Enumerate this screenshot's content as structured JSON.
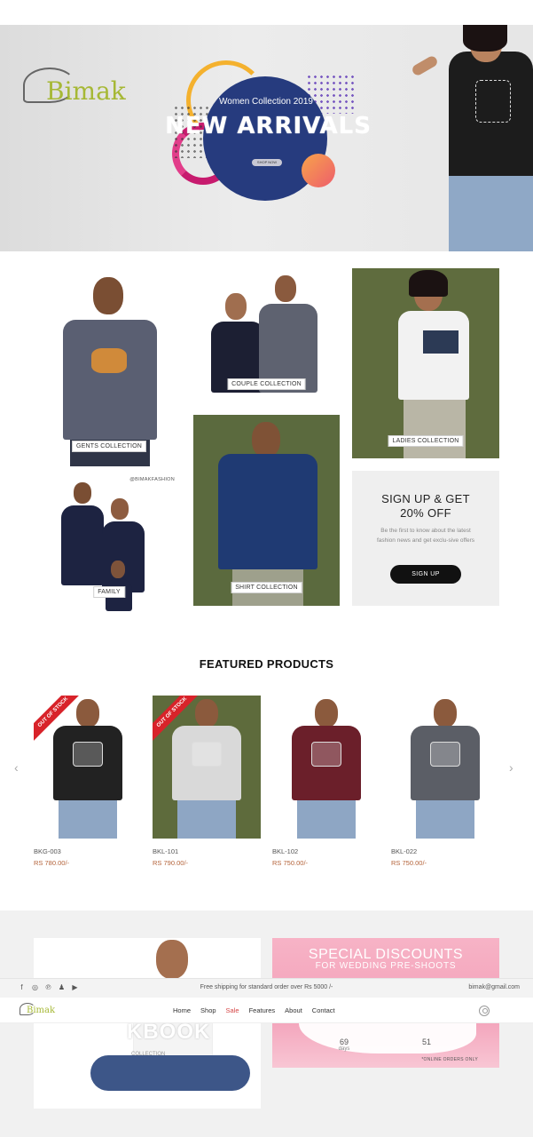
{
  "hero": {
    "logo_text": "Bimak",
    "subtitle": "Women Collection 2019",
    "title": "NEW ARRIVALS",
    "button": "SHOP NOW"
  },
  "collections": {
    "gents": "GENTS COLLECTION",
    "couple": "COUPLE COLLECTION",
    "ladies": "LADIES COLLECTION",
    "family": "FAMILY",
    "shirt": "SHIRT COLLECTION",
    "insta_tag": "@BIMAKFASHION"
  },
  "signup": {
    "title_line1": "SIGN UP & GET",
    "title_line2": "20% OFF",
    "text": "Be the first to know about the latest fashion news and get exclu-sive offers",
    "button": "SIGN UP"
  },
  "featured": {
    "title": "FEATURED PRODUCTS",
    "prev": "‹",
    "next": "›",
    "products": [
      {
        "code": "BKG-003",
        "price": "RS 780.00/-",
        "badge": "OUT OF STOCK",
        "shirt_color": "#222222",
        "bg": "#ffffff"
      },
      {
        "code": "BKL-101",
        "price": "RS 790.00/-",
        "badge": "OUT OF STOCK",
        "shirt_color": "#d9d9d9",
        "bg": "#5e6b3c"
      },
      {
        "code": "BKL-102",
        "price": "RS 750.00/-",
        "badge": "",
        "shirt_color": "#6b1f2a",
        "bg": "#ffffff"
      },
      {
        "code": "BKL-022",
        "price": "RS 750.00/-",
        "badge": "",
        "shirt_color": "#5b5e66",
        "bg": "#ffffff"
      }
    ]
  },
  "promo": {
    "lookbook_text": "KBOOK",
    "lookbook_sub": "COLLECTION",
    "discount_title": "SPECIAL DISCOUNTS",
    "discount_sub": "FOR WEDDING PRE-SHOOTS",
    "countdown": [
      {
        "n": "69",
        "u": "days"
      },
      {
        "n": "",
        "u": ""
      },
      {
        "n": "",
        "u": ""
      },
      {
        "n": "51",
        "u": ""
      }
    ],
    "discount_note": "*ONLINE ORDERS ONLY"
  },
  "topbar": {
    "shipping": "Free shipping for standard order over Rs 5000 /-",
    "email": "bimak@gmail.com",
    "social": [
      "facebook-icon",
      "instagram-icon",
      "pinterest-icon",
      "snapchat-icon",
      "youtube-icon"
    ]
  },
  "nav": {
    "logo_text": "Bimak",
    "items": [
      "Home",
      "Shop",
      "Sale",
      "Features",
      "About",
      "Contact"
    ]
  }
}
